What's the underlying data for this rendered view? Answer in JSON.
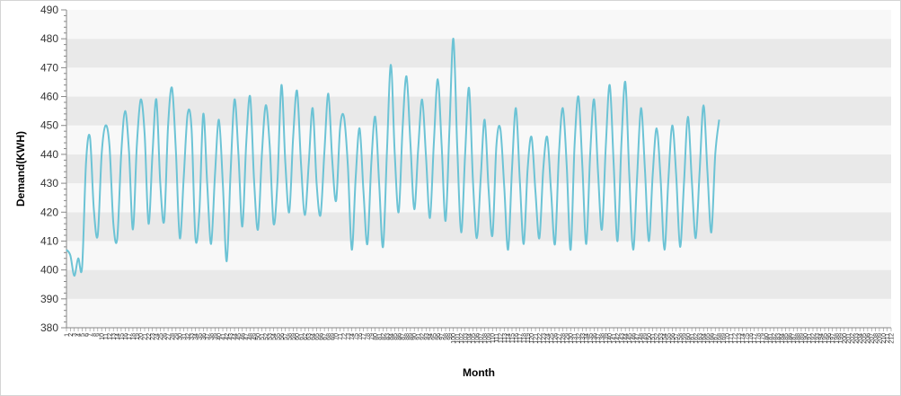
{
  "chart_data": {
    "type": "line",
    "title": "",
    "xlabel": "Month",
    "ylabel": "Demand(KWH)",
    "ylim": [
      380,
      490
    ],
    "yticks": [
      380,
      390,
      400,
      410,
      420,
      430,
      440,
      450,
      460,
      470,
      480,
      490
    ],
    "grid": "horizontal alternating bands",
    "legend": "none",
    "colors": {
      "line": "#6cc3d5",
      "band_dark": "#e9e9e9",
      "band_light": "#f8f8f8",
      "axis": "#888888"
    },
    "x": [
      1,
      2,
      3,
      4,
      5,
      6,
      7,
      8,
      9,
      10,
      11,
      12,
      13,
      14,
      15,
      16,
      17,
      18,
      19,
      20,
      21,
      22,
      23,
      24,
      25,
      26,
      27,
      28,
      29,
      30,
      31,
      32,
      33,
      34,
      35,
      36,
      37,
      38,
      39,
      40,
      41,
      42,
      43,
      44,
      45,
      46,
      47,
      48,
      49,
      50,
      51,
      52,
      53,
      54,
      55,
      56,
      57,
      58,
      59,
      60,
      61,
      62,
      63,
      64,
      65,
      66,
      67,
      68,
      69,
      70,
      71,
      72,
      73,
      74,
      75,
      76,
      77,
      78,
      79,
      80,
      81,
      82,
      83,
      84,
      85,
      86,
      87,
      88,
      89,
      90,
      91,
      92,
      93,
      94,
      95,
      96,
      97,
      98,
      99,
      100,
      101,
      102,
      103,
      104,
      105,
      106,
      107,
      108,
      109,
      110,
      111,
      112,
      113,
      114,
      115,
      116,
      117,
      118,
      119,
      120,
      121,
      122,
      123,
      124,
      125,
      126,
      127,
      128,
      129,
      130,
      131,
      132,
      133,
      134,
      135,
      136,
      137,
      138,
      139,
      140,
      141,
      142,
      143,
      144,
      145,
      146,
      147,
      148,
      149,
      150,
      151,
      152,
      153,
      154,
      155,
      156,
      157,
      158,
      159,
      160,
      161,
      162,
      163,
      164,
      165,
      166,
      167,
      168,
      169,
      170,
      171,
      172,
      173,
      174,
      175,
      176,
      177,
      178,
      179,
      180,
      181,
      182,
      183,
      184,
      185,
      186,
      187,
      188,
      189,
      190,
      191,
      192,
      193,
      194,
      195,
      196,
      197,
      198,
      199,
      200,
      201,
      202,
      203,
      204,
      205,
      206,
      207,
      208,
      209,
      210,
      211,
      212
    ],
    "series": [
      {
        "name": "",
        "values": [
          407,
          405,
          398,
          404,
          401,
          437,
          446,
          421,
          412,
          440,
          450,
          443,
          416,
          411,
          440,
          455,
          441,
          414,
          443,
          459,
          447,
          416,
          440,
          459,
          430,
          417,
          450,
          463,
          441,
          411,
          432,
          454,
          449,
          411,
          420,
          454,
          430,
          409,
          433,
          452,
          430,
          403,
          434,
          459,
          440,
          415,
          444,
          460,
          431,
          414,
          440,
          457,
          443,
          416,
          431,
          464,
          437,
          420,
          446,
          462,
          437,
          419,
          437,
          456,
          430,
          419,
          441,
          461,
          438,
          424,
          449,
          453,
          436,
          407,
          432,
          449,
          427,
          409,
          437,
          453,
          430,
          408,
          441,
          471,
          440,
          420,
          449,
          467,
          444,
          421,
          442,
          459,
          439,
          418,
          444,
          466,
          443,
          417,
          449,
          480,
          442,
          413,
          440,
          463,
          431,
          411,
          432,
          452,
          428,
          412,
          443,
          449,
          429,
          407,
          435,
          456,
          431,
          409,
          435,
          446,
          427,
          411,
          435,
          446,
          427,
          409,
          440,
          456,
          436,
          407,
          443,
          460,
          436,
          409,
          440,
          459,
          434,
          414,
          443,
          464,
          437,
          410,
          444,
          465,
          433,
          407,
          432,
          456,
          435,
          410,
          433,
          449,
          432,
          407,
          431,
          450,
          433,
          408,
          430,
          453,
          431,
          411,
          434,
          457,
          434,
          413,
          440,
          452
        ]
      }
    ]
  }
}
